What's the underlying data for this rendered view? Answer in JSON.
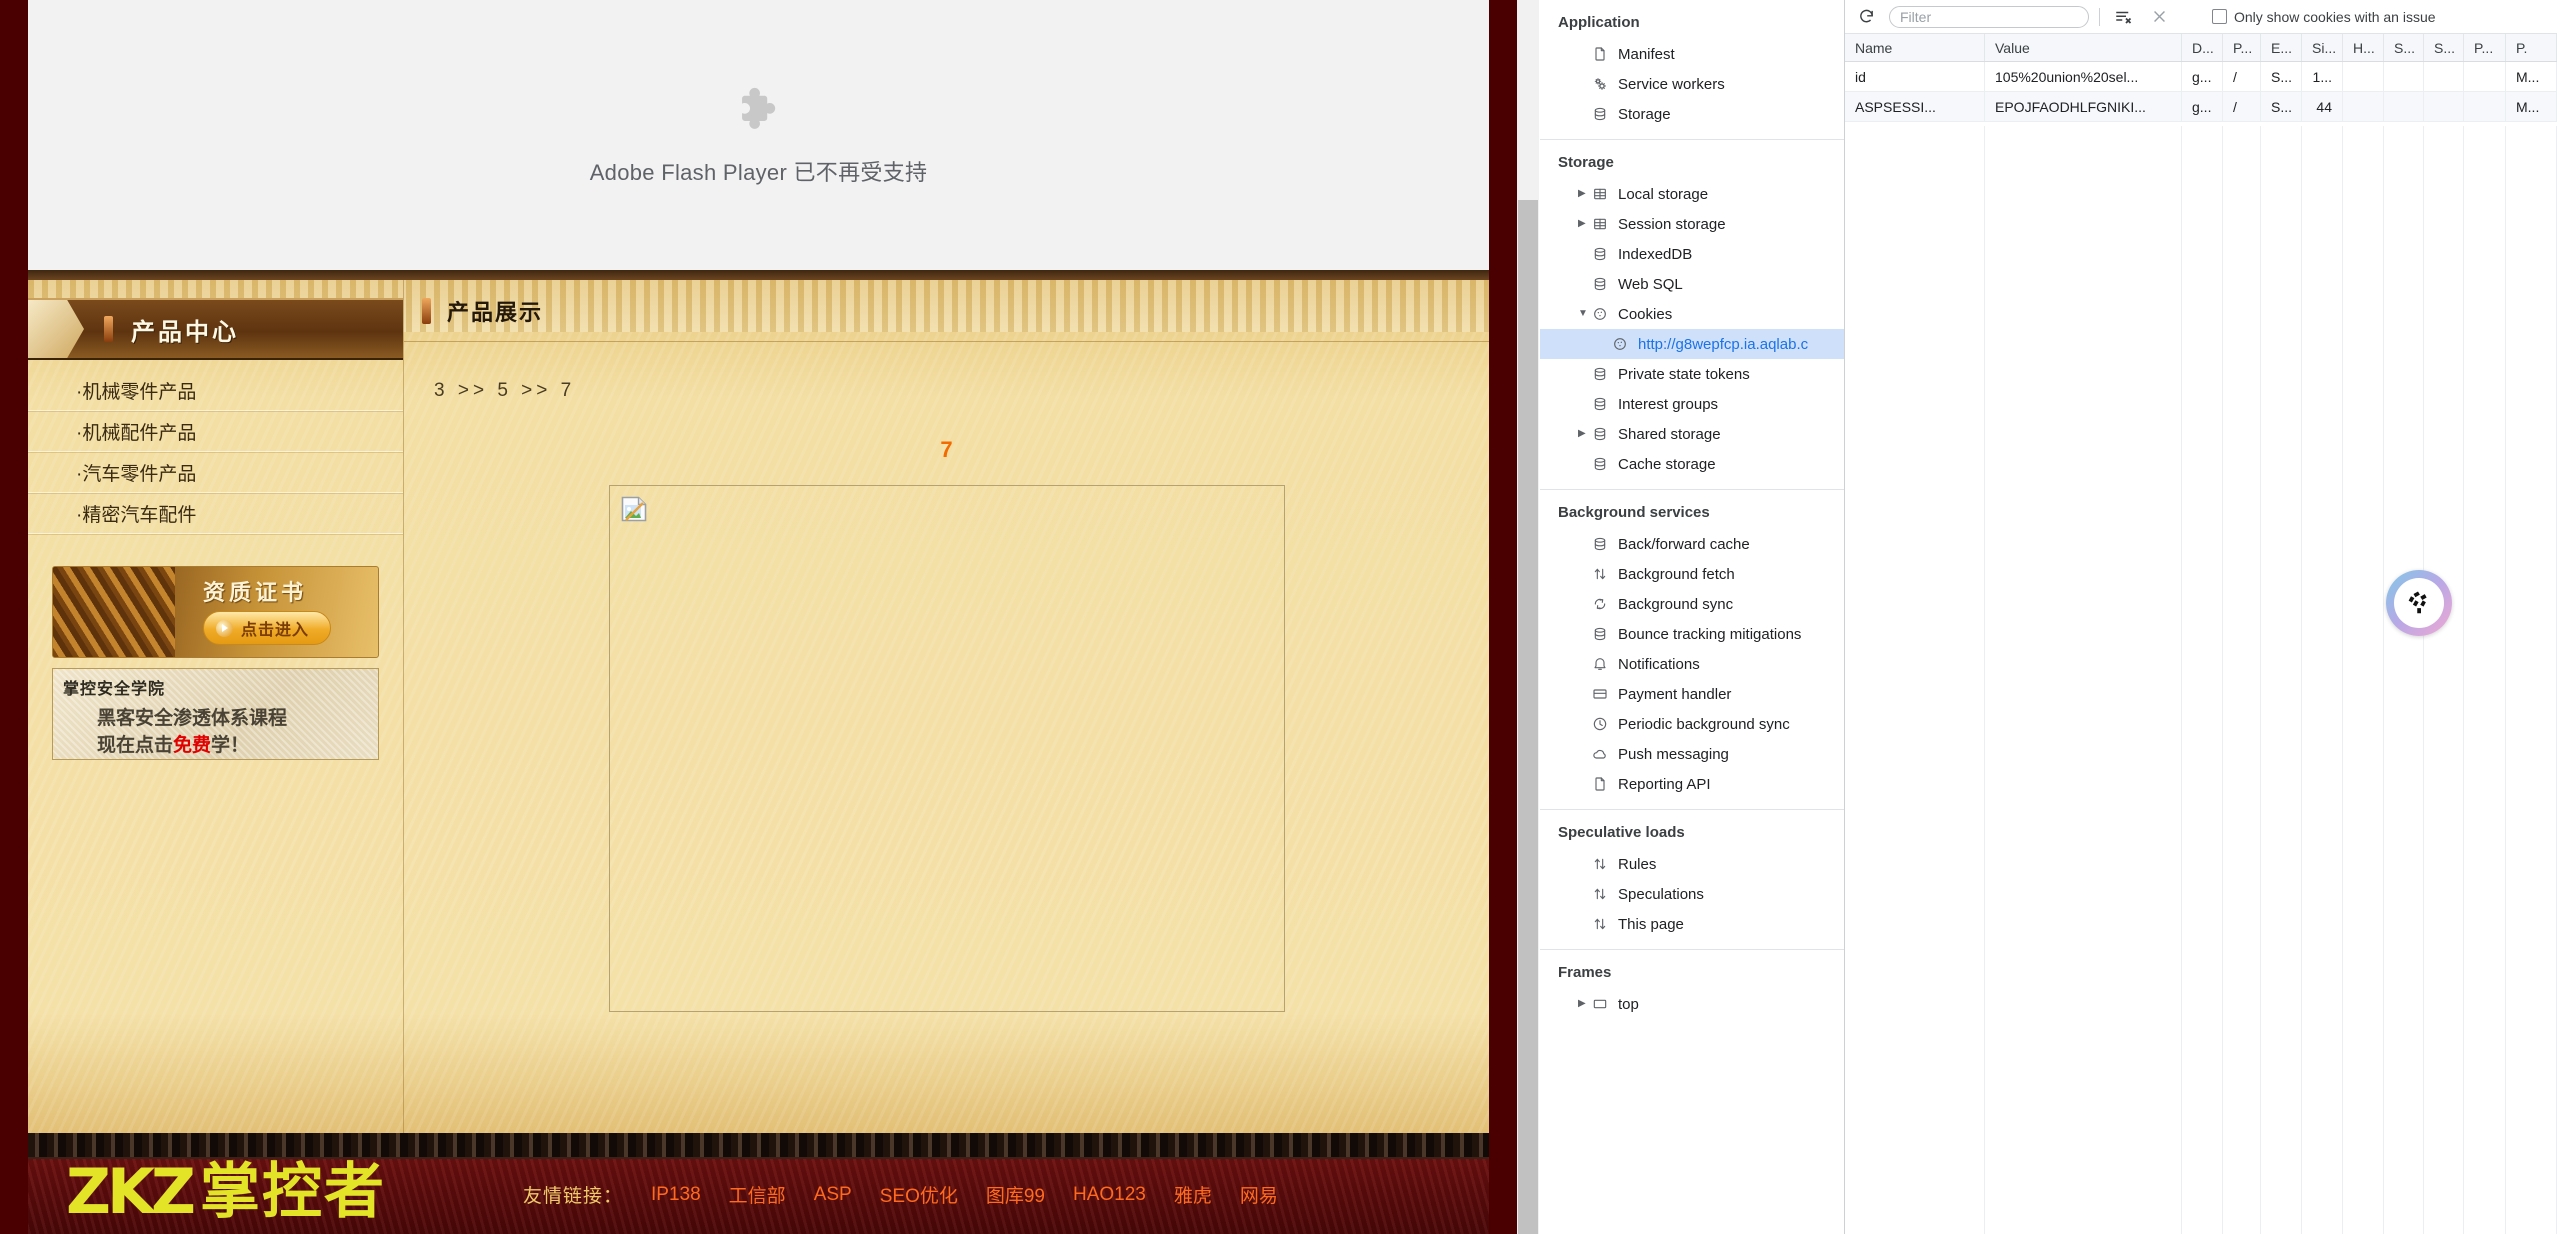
{
  "webpage": {
    "flash_notice": {
      "icon": "puzzle-piece-icon",
      "text": "Adobe Flash Player 已不再受支持"
    },
    "sidebar": {
      "header": "产品中心",
      "items": [
        {
          "label": "·机械零件产品"
        },
        {
          "label": "·机械配件产品"
        },
        {
          "label": "·汽车零件产品"
        },
        {
          "label": "·精密汽车配件"
        }
      ],
      "banner_cert": {
        "title": "资质证书",
        "button": "点击进入"
      },
      "banner_course": {
        "brand": "掌控安全学院",
        "line1": "黑客安全渗透体系课程",
        "line2_prefix": "现在点击",
        "line2_highlight": "免费",
        "line2_suffix": "学！"
      }
    },
    "content": {
      "header": "产品展示",
      "breadcrumb": "3 >> 5 >> 7",
      "product_id": "7",
      "image_placeholder": "broken-image-icon"
    },
    "footer": {
      "logo_mark": "ZKZ",
      "logo_text": "掌控者",
      "links_label": "友情链接：",
      "links": [
        "IP138",
        "工信部",
        "ASP",
        "SEO优化",
        "图库99",
        "HAO123",
        "雅虎",
        "网易"
      ]
    }
  },
  "devtools": {
    "sections": [
      {
        "title": "Application",
        "items": [
          {
            "label": "Manifest",
            "icon": "document-icon",
            "indent": 1,
            "expandable": false,
            "selected": false
          },
          {
            "label": "Service workers",
            "icon": "gears-icon",
            "indent": 1,
            "expandable": false,
            "selected": false
          },
          {
            "label": "Storage",
            "icon": "database-icon",
            "indent": 1,
            "expandable": false,
            "selected": false
          }
        ]
      },
      {
        "title": "Storage",
        "items": [
          {
            "label": "Local storage",
            "icon": "table-icon",
            "indent": 1,
            "expandable": true,
            "expanded": false,
            "selected": false
          },
          {
            "label": "Session storage",
            "icon": "table-icon",
            "indent": 1,
            "expandable": true,
            "expanded": false,
            "selected": false
          },
          {
            "label": "IndexedDB",
            "icon": "database-icon",
            "indent": 1,
            "expandable": false,
            "selected": false
          },
          {
            "label": "Web SQL",
            "icon": "database-icon",
            "indent": 1,
            "expandable": false,
            "selected": false
          },
          {
            "label": "Cookies",
            "icon": "cookie-icon",
            "indent": 1,
            "expandable": true,
            "expanded": true,
            "selected": false
          },
          {
            "label": "http://g8wepfcp.ia.aqlab.c",
            "icon": "cookie-icon",
            "indent": 2,
            "expandable": false,
            "selected": true
          },
          {
            "label": "Private state tokens",
            "icon": "database-icon",
            "indent": 1,
            "expandable": false,
            "selected": false
          },
          {
            "label": "Interest groups",
            "icon": "database-icon",
            "indent": 1,
            "expandable": false,
            "selected": false
          },
          {
            "label": "Shared storage",
            "icon": "database-icon",
            "indent": 1,
            "expandable": true,
            "expanded": false,
            "selected": false
          },
          {
            "label": "Cache storage",
            "icon": "database-icon",
            "indent": 1,
            "expandable": false,
            "selected": false
          }
        ]
      },
      {
        "title": "Background services",
        "items": [
          {
            "label": "Back/forward cache",
            "icon": "database-icon",
            "indent": 1,
            "expandable": false,
            "selected": false
          },
          {
            "label": "Background fetch",
            "icon": "arrows-updown-icon",
            "indent": 1,
            "expandable": false,
            "selected": false
          },
          {
            "label": "Background sync",
            "icon": "sync-icon",
            "indent": 1,
            "expandable": false,
            "selected": false
          },
          {
            "label": "Bounce tracking mitigations",
            "icon": "database-icon",
            "indent": 1,
            "expandable": false,
            "selected": false
          },
          {
            "label": "Notifications",
            "icon": "bell-icon",
            "indent": 1,
            "expandable": false,
            "selected": false
          },
          {
            "label": "Payment handler",
            "icon": "credit-card-icon",
            "indent": 1,
            "expandable": false,
            "selected": false
          },
          {
            "label": "Periodic background sync",
            "icon": "clock-icon",
            "indent": 1,
            "expandable": false,
            "selected": false
          },
          {
            "label": "Push messaging",
            "icon": "cloud-icon",
            "indent": 1,
            "expandable": false,
            "selected": false
          },
          {
            "label": "Reporting API",
            "icon": "document-icon",
            "indent": 1,
            "expandable": false,
            "selected": false
          }
        ]
      },
      {
        "title": "Speculative loads",
        "items": [
          {
            "label": "Rules",
            "icon": "arrows-updown-icon",
            "indent": 1,
            "expandable": false,
            "selected": false
          },
          {
            "label": "Speculations",
            "icon": "arrows-updown-icon",
            "indent": 1,
            "expandable": false,
            "selected": false
          },
          {
            "label": "This page",
            "icon": "arrows-updown-icon",
            "indent": 1,
            "expandable": false,
            "selected": false
          }
        ]
      },
      {
        "title": "Frames",
        "items": [
          {
            "label": "top",
            "icon": "frame-icon",
            "indent": 1,
            "expandable": true,
            "expanded": false,
            "selected": false
          }
        ]
      }
    ],
    "toolbar": {
      "refresh_icon": "refresh-icon",
      "filter_placeholder": "Filter",
      "filter_value": "",
      "clear_filtered_icon": "clear-filtered-icon",
      "delete_icon": "close-icon",
      "issue_checkbox_label": "Only show cookies with an issue",
      "issue_checkbox_checked": false
    },
    "cookie_table": {
      "columns": [
        "Name",
        "Value",
        "D...",
        "P...",
        "E...",
        "Si...",
        "H...",
        "S...",
        "S...",
        "P...",
        "P."
      ],
      "rows": [
        [
          "id",
          "105%20union%20sel...",
          "g...",
          "/",
          "S...",
          "1...",
          "",
          "",
          "",
          "",
          "M..."
        ],
        [
          "ASPSESSI...",
          "EPOJFAODHLFGNIKI...",
          "g...",
          "/",
          "S...",
          "44",
          "",
          "",
          "",
          "",
          "M..."
        ]
      ]
    },
    "float_badge": {
      "icon": "tri-blade-badge-icon"
    }
  }
}
